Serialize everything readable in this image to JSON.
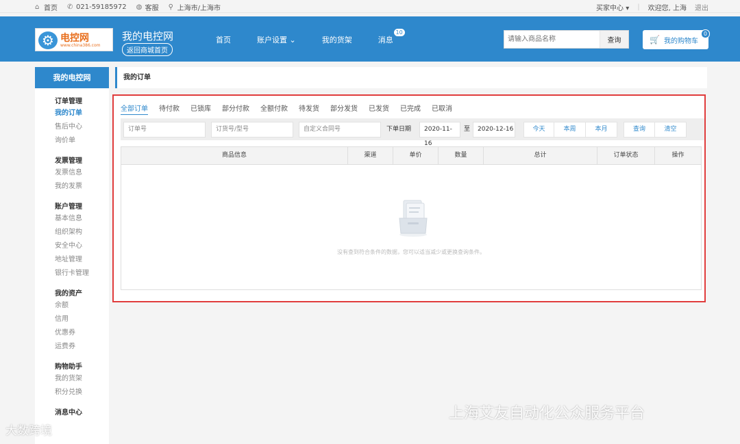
{
  "topbar": {
    "home": "首页",
    "phone": "021-59185972",
    "service": "客服",
    "location": "上海市/上海市",
    "buyer_center": "买家中心",
    "welcome": "欢迎您, 上海",
    "logout": "退出"
  },
  "header": {
    "logo_name": "电控网",
    "logo_url": "www.china386.com",
    "site_title": "我的电控网",
    "back_link": "返回商城首页",
    "nav": [
      "首页",
      "账户设置",
      "我的货架",
      "消息"
    ],
    "message_count": "10",
    "search_placeholder": "请输入商品名称",
    "search_button": "查询",
    "cart_label": "我的购物车",
    "cart_count": "0"
  },
  "sidebar": {
    "title": "我的电控网",
    "groups": [
      {
        "title": "订单管理",
        "items": [
          "我的订单",
          "售后中心",
          "询价单"
        ]
      },
      {
        "title": "发票管理",
        "items": [
          "发票信息",
          "我的发票"
        ]
      },
      {
        "title": "账户管理",
        "items": [
          "基本信息",
          "组织架构",
          "安全中心",
          "地址管理",
          "银行卡管理"
        ]
      },
      {
        "title": "我的资产",
        "items": [
          "余额",
          "信用",
          "优惠券",
          "运费券"
        ]
      },
      {
        "title": "购物助手",
        "items": [
          "我的货架",
          "积分兑换"
        ]
      },
      {
        "title": "消息中心",
        "items": []
      }
    ]
  },
  "main": {
    "page_title": "我的订单",
    "tabs": [
      "全部订单",
      "待付款",
      "已锁库",
      "部分付款",
      "全额付款",
      "待发货",
      "部分发货",
      "已发货",
      "已完成",
      "已取消"
    ],
    "filter": {
      "order_no": "订单号",
      "model_no": "订货号/型号",
      "contract_no": "自定义合同号",
      "date_label": "下单日期",
      "date_from": "2020-11-16",
      "date_sep": "至",
      "date_to": "2020-12-16",
      "today": "今天",
      "this_week": "本周",
      "this_month": "本月",
      "query": "查询",
      "clear": "清空"
    },
    "columns": [
      "商品信息",
      "渠道",
      "单价",
      "数量",
      "总计",
      "订单状态",
      "操作"
    ],
    "empty_text": "没有查到符合条件的数据，您可以适当减少或更换查询条件。"
  },
  "watermarks": {
    "right": "上海艾友自动化公众服务平台",
    "left": "大数跨境"
  },
  "colors": {
    "brand": "#2e88cc",
    "highlight_border": "#e03b3b"
  }
}
